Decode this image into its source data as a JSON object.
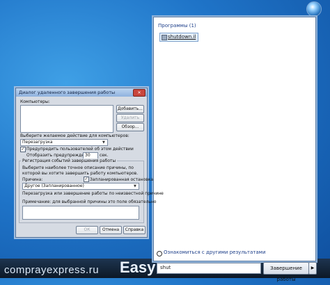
{
  "desktop": {
    "watermark": "comprayexpress.ru",
    "watermark2": "Easy"
  },
  "start_menu": {
    "programs_header": "Программы (1)",
    "program_item": "shutdown.il",
    "more_results": "Ознакомиться с другими результатами",
    "search_value": "shut",
    "shutdown_label": "Завершение работы",
    "shutdown_arrow": "▶"
  },
  "dialog": {
    "title": "Диалог удаленного завершения работы",
    "close": "✕",
    "computers_label": "Компьютеры:",
    "add_button": "Добавить...",
    "remove_button": "Удалить",
    "browse_button": "Обзор...",
    "action_label": "Выберите желаемое действие для компьютеров:",
    "action_value": "Перезагрузка",
    "warn_users_label": "Предупредить пользователей об этом действии",
    "warn_users_checked": true,
    "display_warning_label": "Отобразить предупреждение",
    "display_warning_value": "30",
    "seconds_label": "сек.",
    "event_group_label": "Регистрация событий завершения работы",
    "reason_desc": "Выберите наиболее точное описание причины, по которой вы хотите завершить работу компьютеров.",
    "reason_label": "Причина:",
    "planned_label": "Запланированная остановка",
    "planned_checked": true,
    "reason_value": "Другое (Запланированное)",
    "reason_info": "Перезагрузка или завершение работы по неизвестной причине",
    "note_label": "Примечание: для выбранной причины это поле обязательно",
    "ok_button": "ОК",
    "cancel_button": "Отмена",
    "help_button": "Справка"
  },
  "colors": {
    "desktop": "#1f74c8",
    "titlebar": "#8fb2de"
  }
}
